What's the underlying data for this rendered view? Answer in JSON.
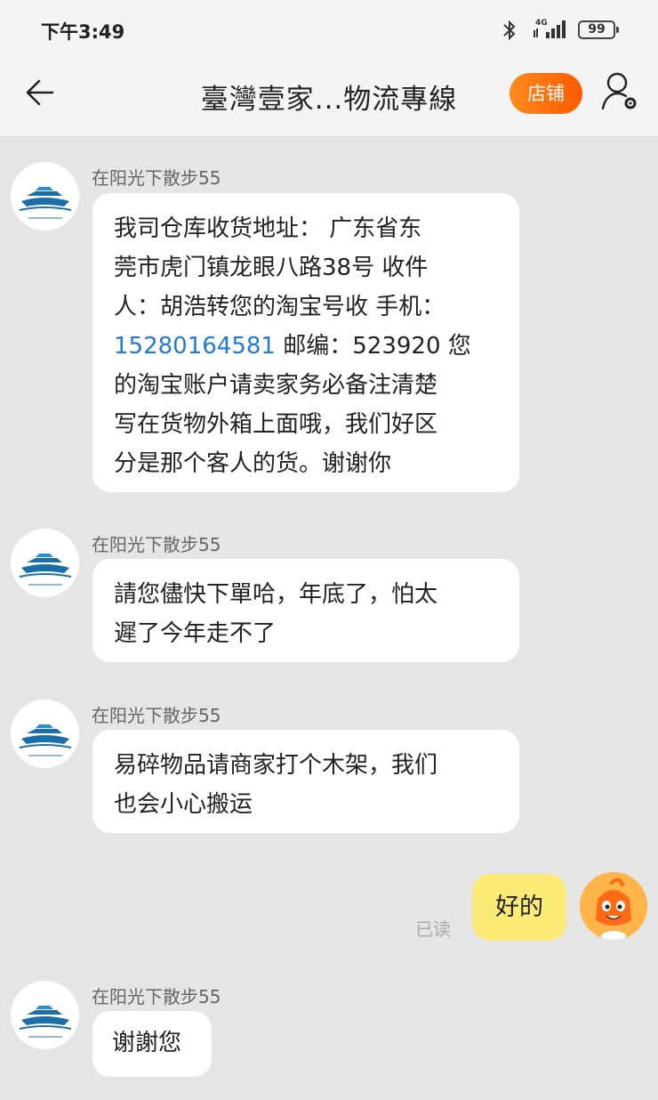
{
  "status_bar": {
    "time": "下午3:49",
    "network": "4G",
    "battery": "99"
  },
  "nav": {
    "title": "臺灣壹家...物流專線",
    "shop_label": "店铺",
    "icons": [
      "back-arrow-icon",
      "user-settings-icon"
    ]
  },
  "messages": [
    {
      "sender": "在阳光下散步55",
      "line1": "我司仓库收货地址： 广东省东",
      "line2": "莞市虎门镇龙眼八路38号 收件",
      "line3": "人：胡浩转您的淘宝号收 手机：",
      "phone": "15280164581",
      "line4_rest": " 邮编：523920 您",
      "line5": "的淘宝账户请卖家务必备注清楚",
      "line6": "写在货物外箱上面哦，我们好区",
      "line7": "分是那个客人的货。谢谢你"
    },
    {
      "sender": "在阳光下散步55",
      "line1": "請您儘快下單哈，年底了，怕太",
      "line2": "遲了今年走不了"
    },
    {
      "sender": "在阳光下散步55",
      "line1": "易碎物品请商家打个木架，我们",
      "line2": "也会小心搬运"
    },
    {
      "text": "谢謝您",
      "sender": "在阳光下散步55"
    }
  ],
  "my_message": {
    "text": "好的",
    "status": "已读"
  },
  "colors": {
    "background": "#e5e5e5",
    "shop_button": "#ff6a00",
    "my_bubble": "#fbeb76",
    "link": "#1f7ad8"
  }
}
